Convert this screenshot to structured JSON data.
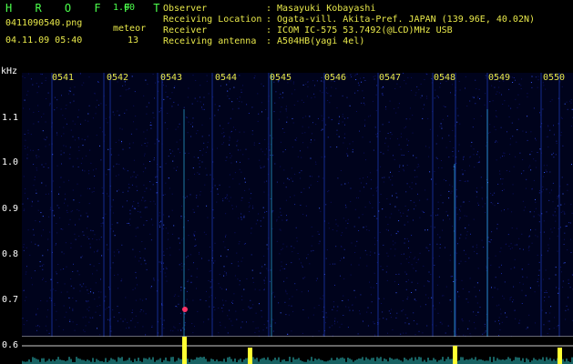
{
  "header": {
    "app_name": "H R O F F T",
    "version": "1.00",
    "filename": "0411090540.png",
    "datetime": "04.11.09 05:40",
    "meteor_label": "meteor",
    "meteor_count": "13",
    "observer_label": "Observer",
    "observer_value": ": Masayuki Kobayashi",
    "location_label": "Receiving Location",
    "location_value": ": Ogata-vill. Akita-Pref. JAPAN (139.96E, 40.02N)",
    "receiver_label": "Receiver",
    "receiver_value": ": ICOM IC-575 53.7492(@LCD)MHz USB",
    "antenna_label": "Receiving antenna",
    "antenna_value": ": A504HB(yagi 4el)"
  },
  "axis": {
    "y_unit": "kHz",
    "y_ticks": [
      "1.1",
      "1.0",
      "0.9",
      "0.8",
      "0.7",
      "0.6"
    ],
    "x_ticks": [
      "0541",
      "0542",
      "0543",
      "0544",
      "0545",
      "0546",
      "0547",
      "0548",
      "0549",
      "0550"
    ]
  },
  "colors": {
    "background": "#000000",
    "spectrum_bg": "#00031c",
    "header_text": "#e8e84a",
    "title_text": "#4cff4c",
    "minute_lines": "#ffff66",
    "meteor_trace": "#33ccff",
    "meteor_head": "#ff3366",
    "baseline": "#cccccc"
  }
}
